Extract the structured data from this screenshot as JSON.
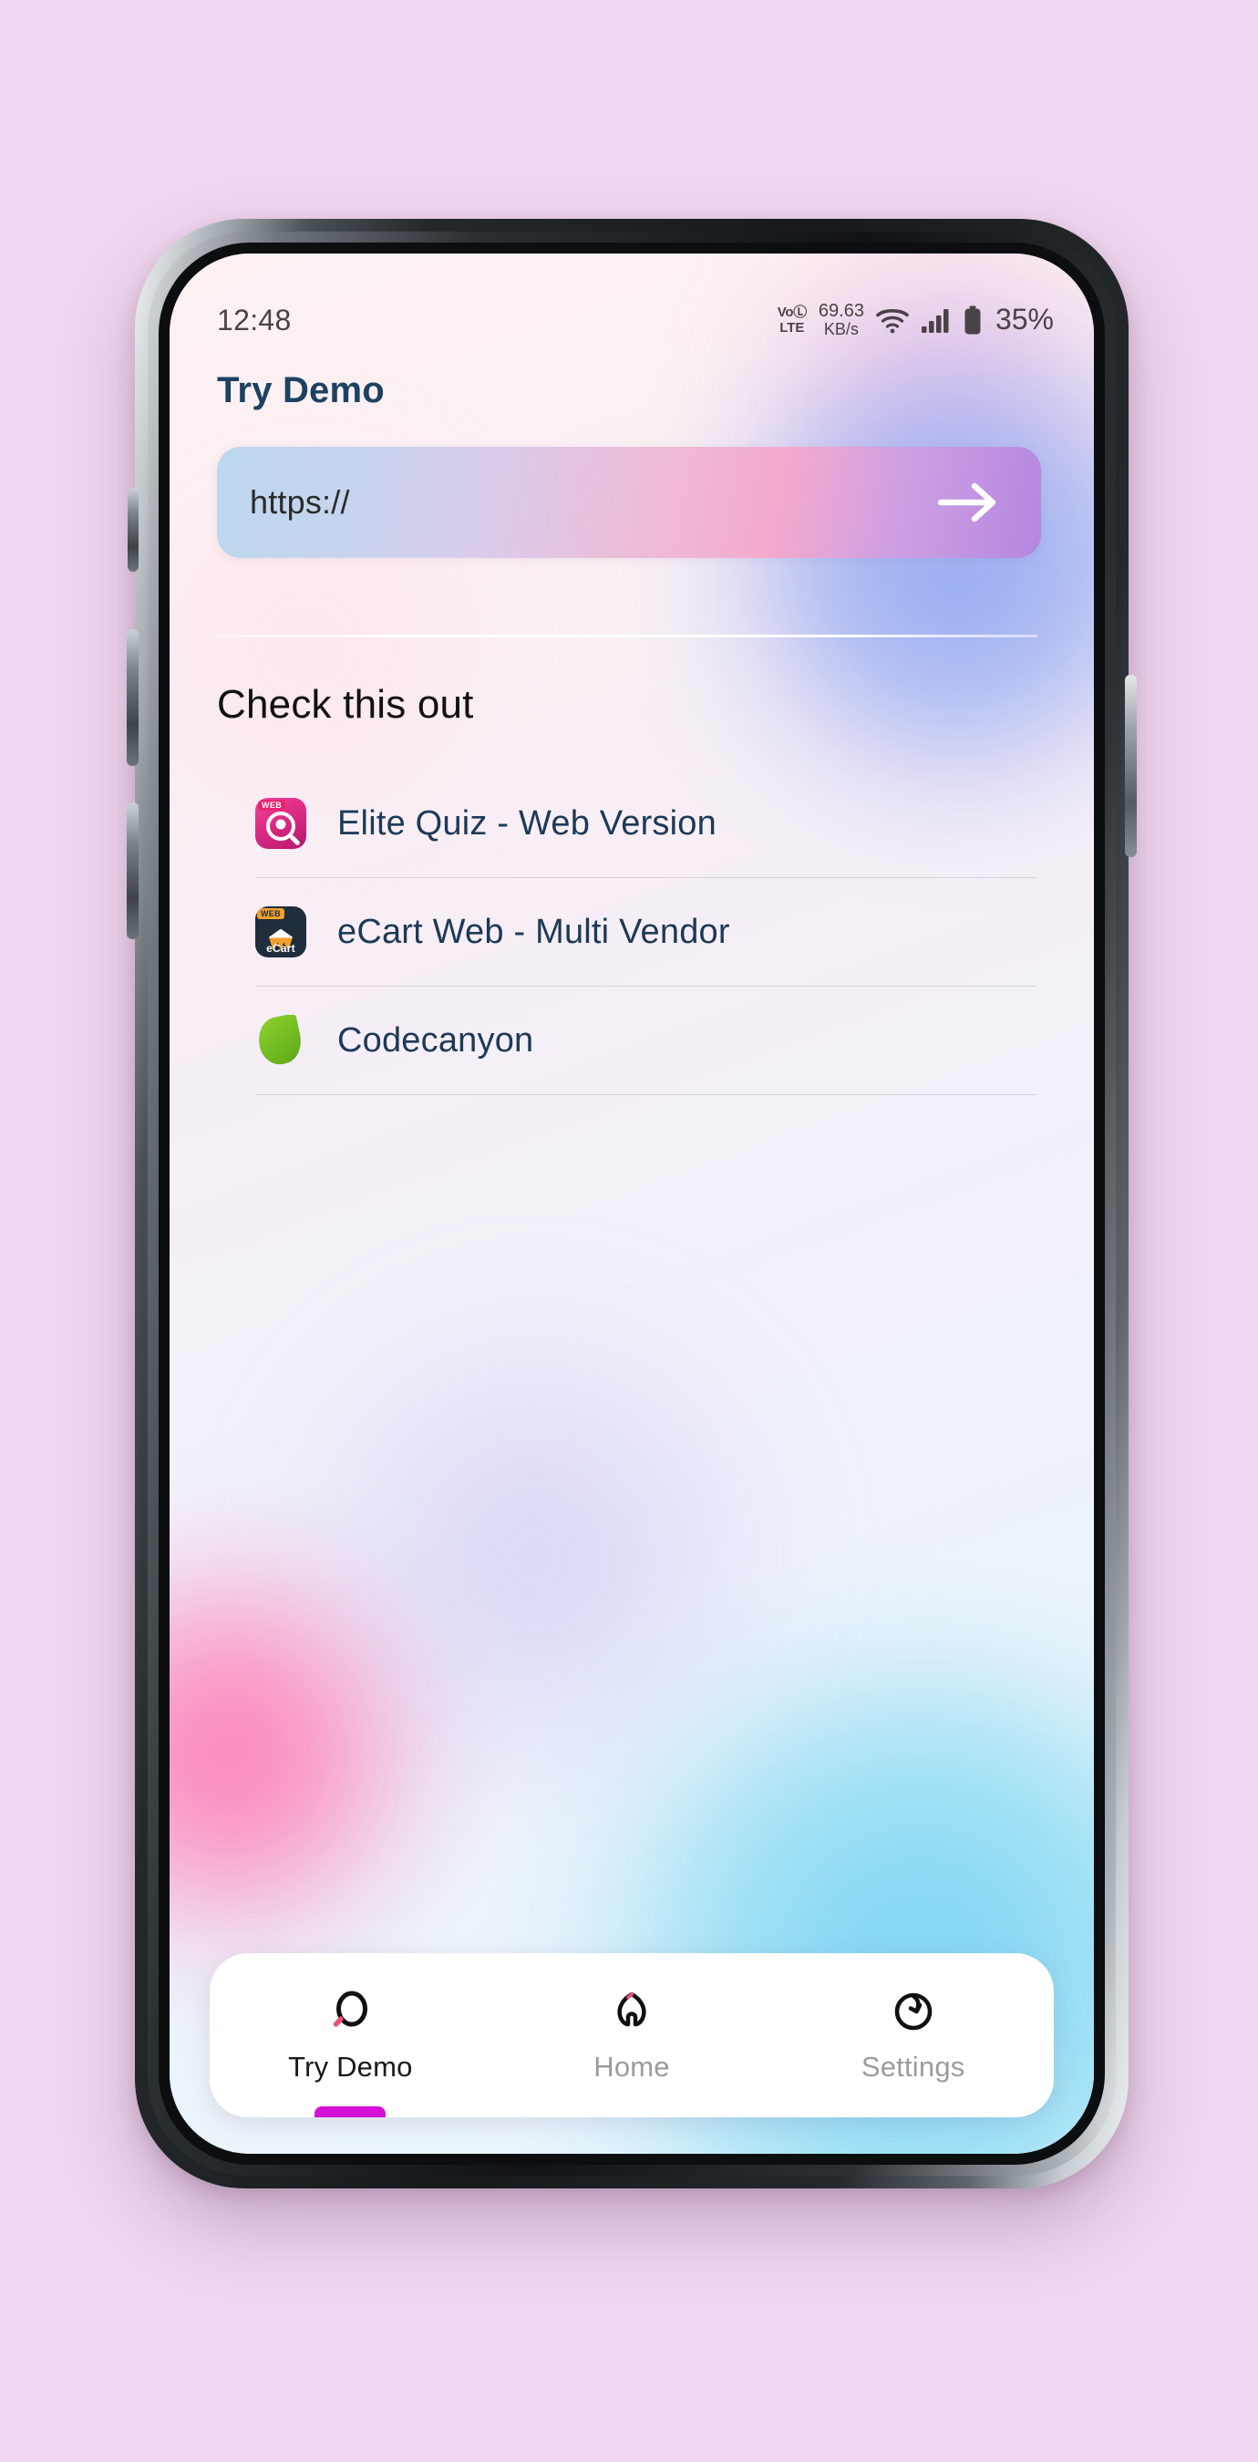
{
  "device": {
    "background_color": "#f0d6ee"
  },
  "status_bar": {
    "time": "12:48",
    "volte_line1": "VoⓁ",
    "volte_line2": "LTE",
    "net_speed_value": "69.63",
    "net_speed_unit": "KB/s",
    "wifi_icon": "wifi-icon",
    "signal_icon": "cellular-signal-icon",
    "battery_icon": "battery-icon",
    "battery_percent": "35%"
  },
  "header": {
    "title": "Try Demo",
    "title_color": "#1d4261"
  },
  "url_field": {
    "value": "https://",
    "placeholder": "https://",
    "submit_icon": "arrow-right-icon",
    "gradient_start": "#bcd8ee",
    "gradient_mid": "#f3a9cd",
    "gradient_end": "#b387e0"
  },
  "section": {
    "title": "Check this out"
  },
  "demo_list": [
    {
      "icon": "elite-quiz-app-icon",
      "badge": "WEB",
      "label": "Elite Quiz - Web Version"
    },
    {
      "icon": "ecart-app-icon",
      "badge": "WEB",
      "name": "eCart",
      "label": "eCart Web - Multi Vendor"
    },
    {
      "icon": "codecanyon-leaf-icon",
      "label": "Codecanyon"
    }
  ],
  "bottom_nav": {
    "active_index": 0,
    "indicator_color": "#d511d5",
    "items": [
      {
        "icon": "search-icon",
        "label": "Try Demo"
      },
      {
        "icon": "home-icon",
        "label": "Home"
      },
      {
        "icon": "refresh-settings-icon",
        "label": "Settings"
      }
    ]
  }
}
